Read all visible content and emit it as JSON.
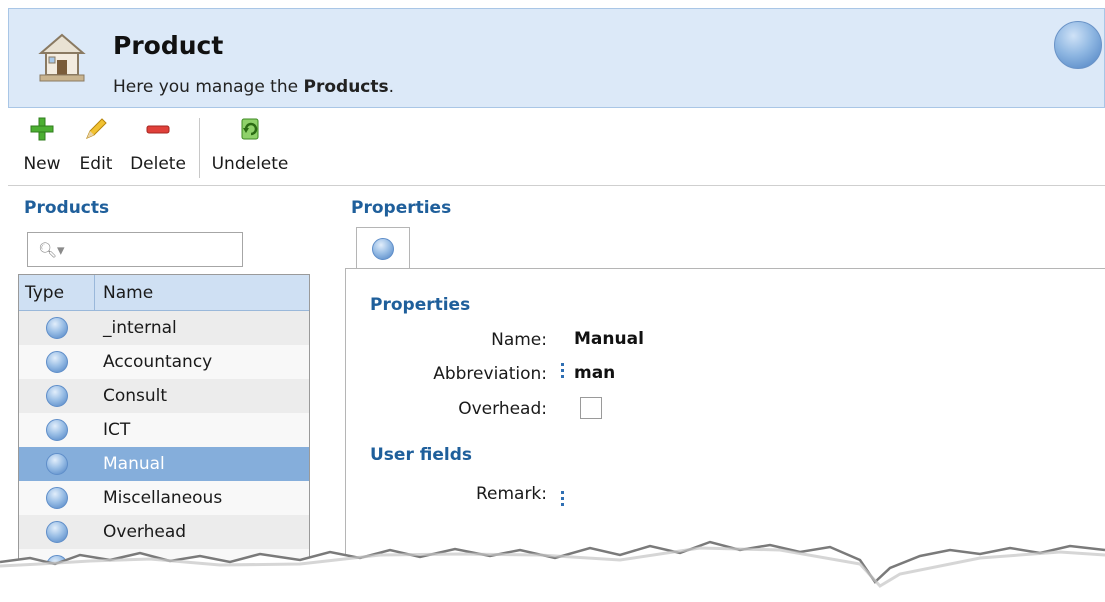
{
  "header": {
    "title": "Product",
    "subtitle_prefix": "Here you manage the ",
    "subtitle_bold": "Products",
    "subtitle_suffix": "."
  },
  "toolbar": {
    "new_label": "New",
    "edit_label": "Edit",
    "delete_label": "Delete",
    "undelete_label": "Undelete"
  },
  "products": {
    "title": "Products",
    "search_placeholder": "",
    "columns": [
      "Type",
      "Name"
    ],
    "rows": [
      {
        "name": "_internal"
      },
      {
        "name": "Accountancy"
      },
      {
        "name": "Consult"
      },
      {
        "name": "ICT"
      },
      {
        "name": "Manual",
        "selected": true
      },
      {
        "name": "Miscellaneous"
      },
      {
        "name": "Overhead"
      }
    ]
  },
  "properties": {
    "title": "Properties",
    "section_title": "Properties",
    "name_label": "Name:",
    "name_value": "Manual",
    "abbreviation_label": "Abbreviation:",
    "abbreviation_value": "man",
    "overhead_label": "Overhead:",
    "overhead_checked": false,
    "user_fields_title": "User fields",
    "remark_label": "Remark:",
    "remark_value": ""
  },
  "colors": {
    "accent": "#1f5f9b",
    "header_bg": "#dce9f8",
    "selected_row": "#85aedb"
  }
}
